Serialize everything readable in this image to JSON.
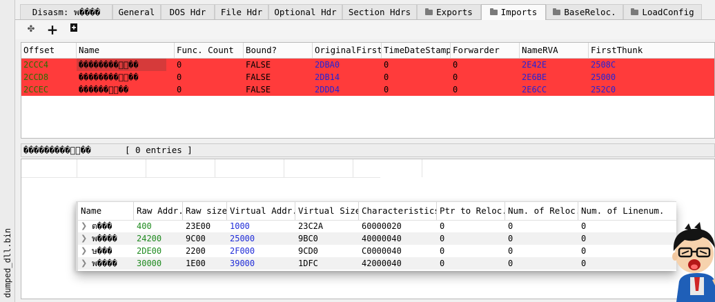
{
  "sidebar": {
    "file_label": "dumped_dll.bin"
  },
  "tabs": [
    {
      "label": "Disasm: พ����"
    },
    {
      "label": "General"
    },
    {
      "label": "DOS Hdr"
    },
    {
      "label": "File Hdr"
    },
    {
      "label": "Optional Hdr"
    },
    {
      "label": "Section Hdrs"
    },
    {
      "label": "Exports"
    },
    {
      "label": "Imports"
    },
    {
      "label": "BaseReloc."
    },
    {
      "label": "LoadConfig"
    }
  ],
  "active_tab": "Imports",
  "toolbar": {
    "move_icon": "✤",
    "add_icon": "+",
    "save_icon": "🖨"
  },
  "imports": {
    "columns": [
      "Offset",
      "Name",
      "Func. Count",
      "Bound?",
      "OriginalFirst",
      "TimeDateStamp",
      "Forwarder",
      "NameRVA",
      "FirstThunk"
    ],
    "rows": [
      {
        "offset": "2CCC4",
        "name": "��������ำ��",
        "func_count": "0",
        "bound": "FALSE",
        "original_first": "2DBA0",
        "time_date_stamp": "0",
        "forwarder": "0",
        "name_rva": "2E42E",
        "first_thunk": "2508C"
      },
      {
        "offset": "2CCD8",
        "name": "��������ำ��",
        "func_count": "0",
        "bound": "FALSE",
        "original_first": "2DB14",
        "time_date_stamp": "0",
        "forwarder": "0",
        "name_rva": "2E6BE",
        "first_thunk": "25000"
      },
      {
        "offset": "2CCEC",
        "name": "������ำ��",
        "func_count": "0",
        "bound": "FALSE",
        "original_first": "2DDD4",
        "time_date_stamp": "0",
        "forwarder": "0",
        "name_rva": "2E6CC",
        "first_thunk": "252C0"
      }
    ],
    "highlight_color": "#ff3b3b"
  },
  "details": {
    "name": "���������ำ��",
    "entries": "[ 0 entries ]"
  },
  "sections": {
    "columns": [
      "Name",
      "Raw Addr.",
      "Raw size",
      "Virtual Addr.",
      "Virtual Size",
      "Characteristics",
      "Ptr to Reloc.",
      "Num. of Reloc.",
      "Num. of Linenum."
    ],
    "rows": [
      {
        "name": "ต���",
        "raw_addr": "400",
        "raw_size": "23E00",
        "virtual_addr": "1000",
        "virtual_size": "23C2A",
        "characteristics": "60000020",
        "ptr_reloc": "0",
        "num_reloc": "0",
        "num_linenum": "0"
      },
      {
        "name": "พ����",
        "raw_addr": "24200",
        "raw_size": "9C00",
        "virtual_addr": "25000",
        "virtual_size": "9BC0",
        "characteristics": "40000040",
        "ptr_reloc": "0",
        "num_reloc": "0",
        "num_linenum": "0"
      },
      {
        "name": "ษ���",
        "raw_addr": "2DE00",
        "raw_size": "2200",
        "virtual_addr": "2F000",
        "virtual_size": "9CD0",
        "characteristics": "C0000040",
        "ptr_reloc": "0",
        "num_reloc": "0",
        "num_linenum": "0"
      },
      {
        "name": "พ����",
        "raw_addr": "30000",
        "raw_size": "1E00",
        "virtual_addr": "39000",
        "virtual_size": "1DFC",
        "characteristics": "42000040",
        "ptr_reloc": "0",
        "num_reloc": "0",
        "num_linenum": "0"
      }
    ]
  }
}
